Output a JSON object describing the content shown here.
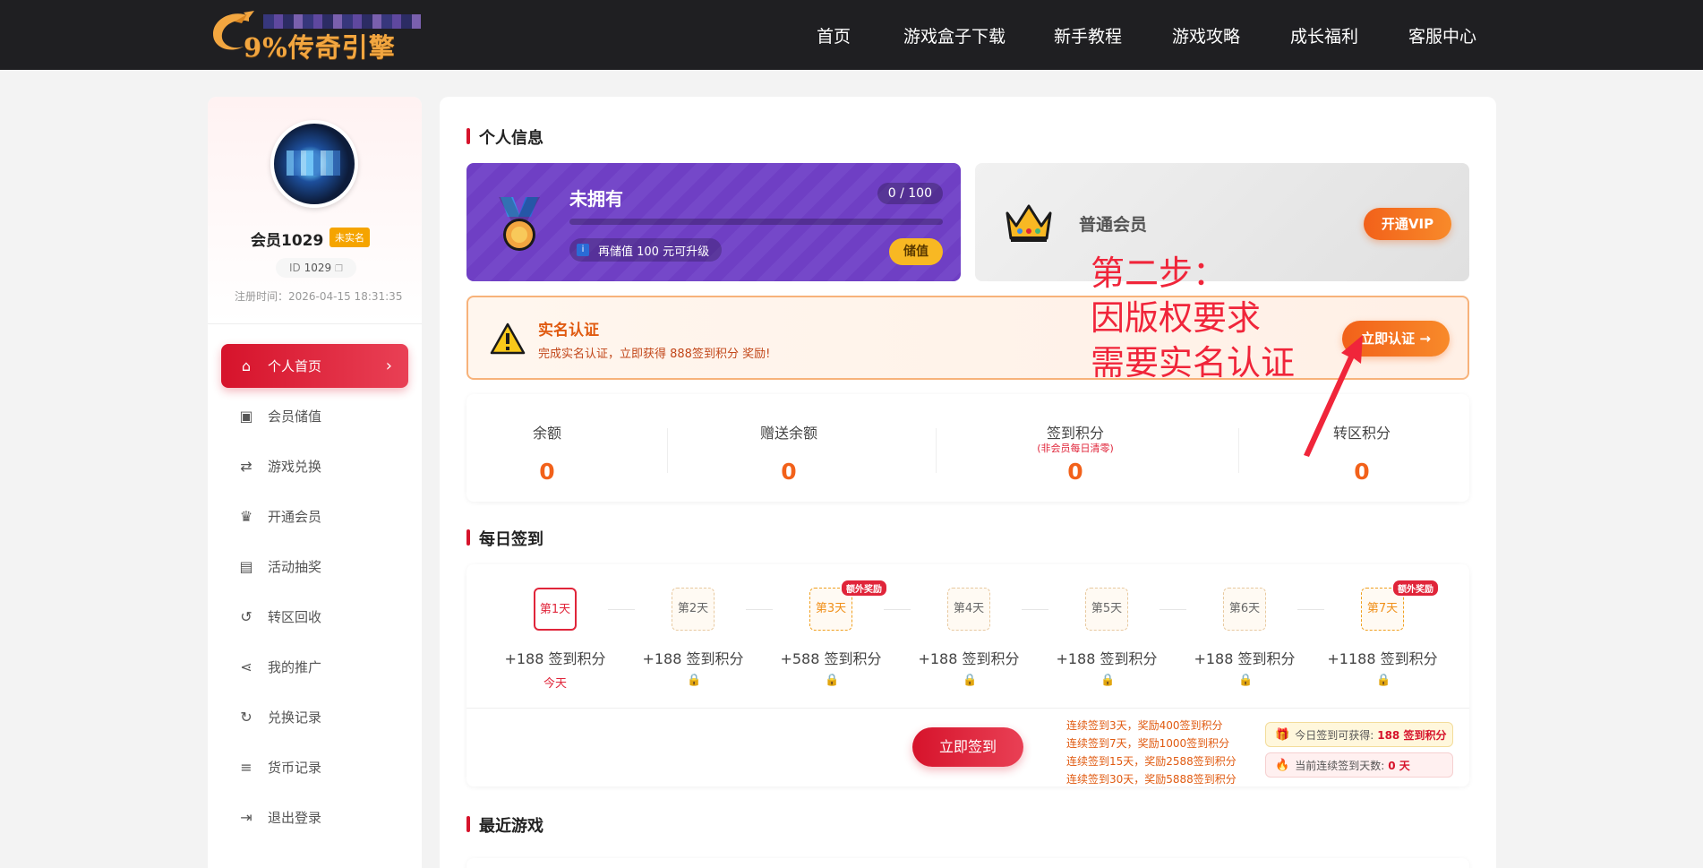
{
  "brand": {
    "logo_text": "9%传奇引擎"
  },
  "nav": {
    "items": [
      "首页",
      "游戏盒子下载",
      "新手教程",
      "游戏攻略",
      "成长福利",
      "客服中心"
    ]
  },
  "user": {
    "name": "会员1029",
    "badge": "未实名",
    "id_label": "ID",
    "id_value": "1029",
    "register": "注册时间：2026-04-15 18:31:35"
  },
  "sidebar": {
    "items": [
      {
        "label": "个人首页",
        "icon": "home-icon"
      },
      {
        "label": "会员储值",
        "icon": "money-icon"
      },
      {
        "label": "游戏兑换",
        "icon": "exchange-icon"
      },
      {
        "label": "开通会员",
        "icon": "crown-icon"
      },
      {
        "label": "活动抽奖",
        "icon": "gift-icon"
      },
      {
        "label": "转区回收",
        "icon": "undo-icon"
      },
      {
        "label": "我的推广",
        "icon": "share-icon"
      },
      {
        "label": "兑换记录",
        "icon": "history-icon"
      },
      {
        "label": "货币记录",
        "icon": "coins-icon"
      },
      {
        "label": "退出登录",
        "icon": "logout-icon"
      }
    ],
    "active_index": 0
  },
  "profile": {
    "section_title": "个人信息",
    "level_card": {
      "title": "未拥有",
      "count": "0 / 100",
      "progress": 0,
      "tip": "再储值 100 元可升级",
      "button": "储值"
    },
    "member_card": {
      "title": "普通会员",
      "button": "开通VIP"
    },
    "realname": {
      "title": "实名认证",
      "desc": "完成实名认证，立即获得 888签到积分 奖励!",
      "button": "立即认证 →"
    },
    "balances": [
      {
        "label": "余额",
        "sub": "",
        "value": "0"
      },
      {
        "label": "赠送余额",
        "sub": "",
        "value": "0"
      },
      {
        "label": "签到积分",
        "sub": "(非会员每日清零)",
        "value": "0"
      },
      {
        "label": "转区积分",
        "sub": "",
        "value": "0"
      }
    ]
  },
  "annotation": {
    "text": "第二步：\n因版权要求\n需要实名认证",
    "color": "#f0253a"
  },
  "signin": {
    "section_title": "每日签到",
    "days": [
      {
        "label": "第1天",
        "points": "+188 签到积分",
        "note": "今天",
        "state": "today",
        "tag": ""
      },
      {
        "label": "第2天",
        "points": "+188 签到积分",
        "note": "",
        "state": "locked",
        "tag": ""
      },
      {
        "label": "第3天",
        "points": "+588 签到积分",
        "note": "",
        "state": "special",
        "tag": "额外奖励"
      },
      {
        "label": "第4天",
        "points": "+188 签到积分",
        "note": "",
        "state": "locked",
        "tag": ""
      },
      {
        "label": "第5天",
        "points": "+188 签到积分",
        "note": "",
        "state": "locked",
        "tag": ""
      },
      {
        "label": "第6天",
        "points": "+188 签到积分",
        "note": "",
        "state": "locked",
        "tag": ""
      },
      {
        "label": "第7天",
        "points": "+1188 签到积分",
        "note": "",
        "state": "special",
        "tag": "额外奖励"
      }
    ],
    "button": "立即签到",
    "rules": [
      "连续签到3天，奖励400签到积分",
      "连续签到7天，奖励1000签到积分",
      "连续签到15天，奖励2588签到积分",
      "连续签到30天，奖励5888签到积分"
    ],
    "today_label": "今日签到可获得:",
    "today_value": "188 签到积分",
    "streak_label": "当前连续签到天数:",
    "streak_value": "0 天"
  },
  "recent": {
    "section_title": "最近游戏"
  },
  "colors": {
    "accent": "#d6132b",
    "orange": "#f2611a",
    "purple": "#6f3fc4",
    "nav_bg": "#1f1f22"
  }
}
